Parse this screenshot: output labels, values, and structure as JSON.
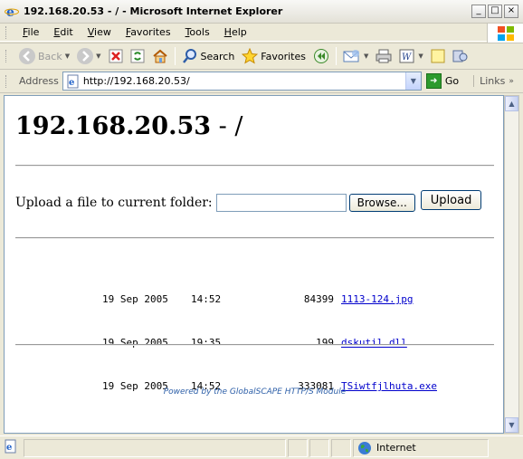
{
  "window": {
    "title": "192.168.20.53 - / - Microsoft Internet Explorer",
    "controls": [
      "_",
      "□",
      "×"
    ]
  },
  "menu": [
    "File",
    "Edit",
    "View",
    "Favorites",
    "Tools",
    "Help"
  ],
  "toolbar": {
    "back_label": "Back",
    "search_label": "Search",
    "favorites_label": "Favorites"
  },
  "address": {
    "label": "Address",
    "url": "http://192.168.20.53/",
    "go_label": "Go",
    "links_label": "Links",
    "links_more": "»"
  },
  "page": {
    "host": "192.168.20.53",
    "path_suffix": " - /",
    "upload_label": "Upload a file to current folder:",
    "browse_label": "Browse...",
    "upload_button": "Upload",
    "files": [
      {
        "date": "19 Sep 2005",
        "time": "14:52",
        "size": "84399",
        "name": "1113-124.jpg"
      },
      {
        "date": "19 Sep 2005",
        "time": "19:35",
        "size": "199",
        "name": "dskutil.dll"
      },
      {
        "date": "19 Sep 2005",
        "time": "14:52",
        "size": "333081",
        "name": "TSiwtfjlhuta.exe"
      }
    ],
    "footer": "Powered by the GlobalSCAPE HTTP/S Module"
  },
  "status": {
    "zone": "Internet"
  },
  "colors": {
    "link": "#0000cc",
    "footer": "#2d5fa8",
    "chrome": "#ece9d8"
  }
}
